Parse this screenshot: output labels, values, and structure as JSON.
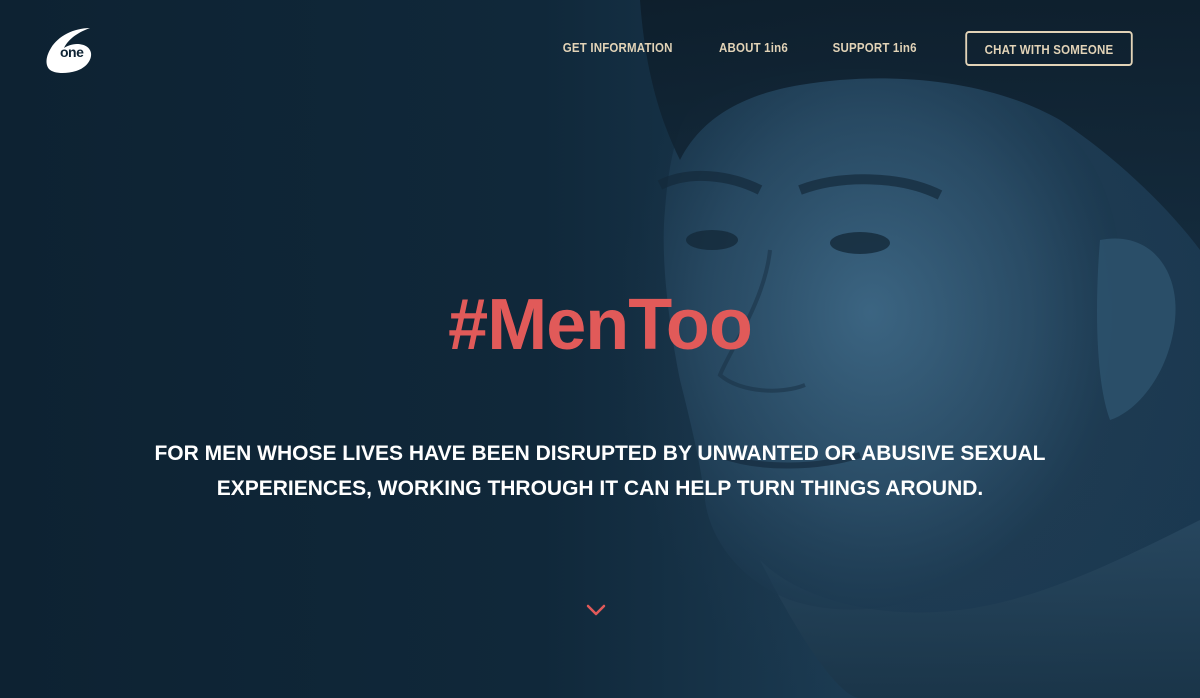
{
  "header": {
    "logo_text": "one",
    "nav": {
      "get_information": "GET INFORMATION",
      "about": "ABOUT 1in6",
      "support": "SUPPORT 1in6",
      "chat": "CHAT WITH SOMEONE"
    }
  },
  "hero": {
    "headline": "#MenToo",
    "subhead": "FOR MEN WHOSE LIVES HAVE BEEN DISRUPTED BY UNWANTED OR ABUSIVE SEXUAL EXPERIENCES, WORKING THROUGH IT CAN HELP TURN THINGS AROUND.",
    "scroll_icon": "chevron-down-icon"
  },
  "colors": {
    "background": "#0f2434",
    "accent": "#e15a59",
    "nav_text": "#e2d3b7",
    "body_text": "#ffffff"
  }
}
